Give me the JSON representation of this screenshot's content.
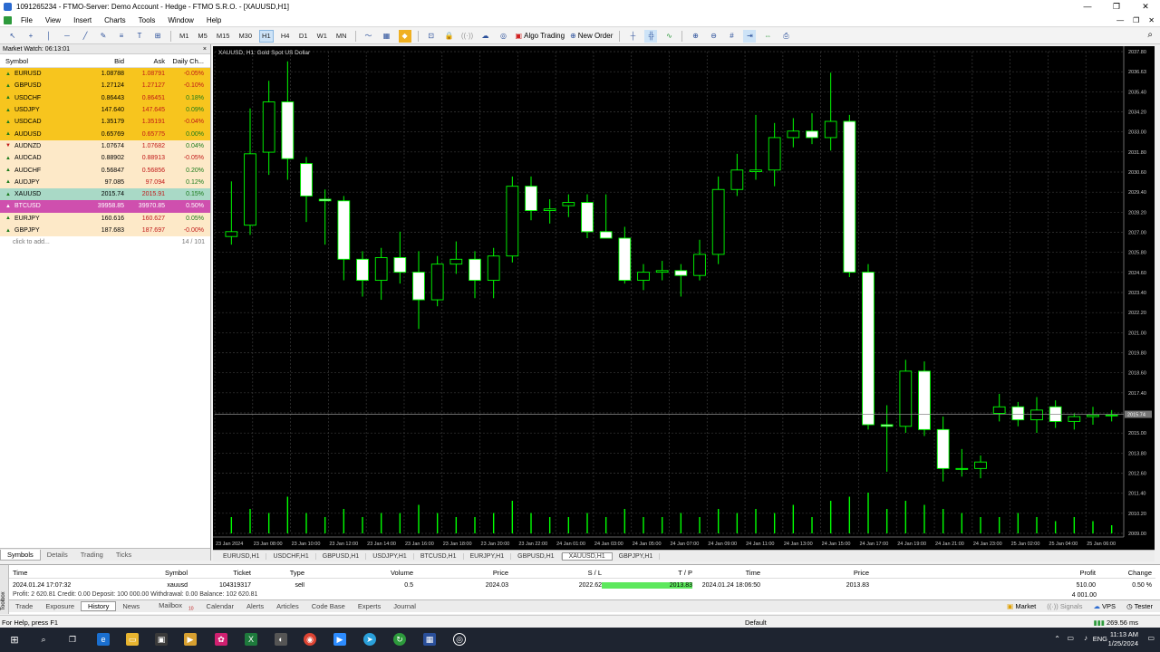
{
  "window": {
    "title": "1091265234 - FTMO-Server: Demo Account - Hedge - FTMO S.R.O. - [XAUUSD,H1]",
    "controls": [
      "—",
      "❐",
      "✕"
    ]
  },
  "menu": {
    "items": [
      "File",
      "View",
      "Insert",
      "Charts",
      "Tools",
      "Window",
      "Help"
    ],
    "mdi_controls": [
      "—",
      "❐",
      "✕"
    ]
  },
  "toolbar": {
    "timeframes": [
      "M1",
      "M5",
      "M15",
      "M30",
      "H1",
      "H4",
      "D1",
      "W1",
      "MN"
    ],
    "active_timeframe": "H1",
    "algo_trading_label": "Algo Trading",
    "new_order_label": "New Order"
  },
  "market_watch": {
    "title": "Market Watch: 06:13:01",
    "headers": {
      "symbol": "Symbol",
      "bid": "Bid",
      "ask": "Ask",
      "change": "Daily Ch..."
    },
    "rows": [
      {
        "symbol": "EURUSD",
        "bid": "1.08788",
        "ask": "1.08791",
        "change": "-0.05%",
        "bg": "#f7c51e",
        "dir": "up"
      },
      {
        "symbol": "GBPUSD",
        "bid": "1.27124",
        "ask": "1.27127",
        "change": "-0.10%",
        "bg": "#f7c51e",
        "dir": "up"
      },
      {
        "symbol": "USDCHF",
        "bid": "0.86443",
        "ask": "0.86451",
        "change": "0.18%",
        "bg": "#f7c51e",
        "dir": "up"
      },
      {
        "symbol": "USDJPY",
        "bid": "147.640",
        "ask": "147.645",
        "change": "0.09%",
        "bg": "#f7c51e",
        "dir": "up"
      },
      {
        "symbol": "USDCAD",
        "bid": "1.35179",
        "ask": "1.35191",
        "change": "-0.04%",
        "bg": "#f7c51e",
        "dir": "up"
      },
      {
        "symbol": "AUDUSD",
        "bid": "0.65769",
        "ask": "0.65775",
        "change": "0.00%",
        "bg": "#f7c51e",
        "dir": "up"
      },
      {
        "symbol": "AUDNZD",
        "bid": "1.07674",
        "ask": "1.07682",
        "change": "0.04%",
        "bg": "#fde9c8",
        "dir": "dn"
      },
      {
        "symbol": "AUDCAD",
        "bid": "0.88902",
        "ask": "0.88913",
        "change": "-0.05%",
        "bg": "#fde9c8",
        "dir": "up"
      },
      {
        "symbol": "AUDCHF",
        "bid": "0.56847",
        "ask": "0.56856",
        "change": "0.20%",
        "bg": "#fde9c8",
        "dir": "up"
      },
      {
        "symbol": "AUDJPY",
        "bid": "97.085",
        "ask": "97.094",
        "change": "0.12%",
        "bg": "#fde9c8",
        "dir": "up"
      },
      {
        "symbol": "XAUUSD",
        "bid": "2015.74",
        "ask": "2015.91",
        "change": "0.15%",
        "bg": "#a9d9c6",
        "dir": "up"
      },
      {
        "symbol": "BTCUSD",
        "bid": "39958.85",
        "ask": "39970.85",
        "change": "0.50%",
        "bg": "#cf4fae",
        "dir": "up"
      },
      {
        "symbol": "EURJPY",
        "bid": "160.616",
        "ask": "160.627",
        "change": "0.05%",
        "bg": "#fde9c8",
        "dir": "up"
      },
      {
        "symbol": "GBPJPY",
        "bid": "187.683",
        "ask": "187.697",
        "change": "-0.00%",
        "bg": "#fde9c8",
        "dir": "up"
      }
    ],
    "add_label": "click to add...",
    "count": "14 / 101",
    "tabs": [
      "Symbols",
      "Details",
      "Trading",
      "Ticks"
    ],
    "active_tab": "Symbols"
  },
  "chart": {
    "title": "XAUUSD, H1:  Gold Spot US Dollar",
    "current_price_label": "2015.74",
    "tabs": [
      "EURUSD,H1",
      "USDCHF,H1",
      "GBPUSD,H1",
      "USDJPY,H1",
      "BTCUSD,H1",
      "EURJPY,H1",
      "GBPUSD,H1",
      "XAUUSD,H1",
      "GBPJPY,H1"
    ],
    "active_tab": "XAUUSD,H1"
  },
  "chart_data": {
    "type": "candlestick",
    "symbol": "XAUUSD",
    "timeframe": "H1",
    "price_ticks": [
      "2037.80",
      "2036.63",
      "2035.40",
      "2034.20",
      "2033.00",
      "2031.80",
      "2030.60",
      "2029.40",
      "2028.20",
      "2027.00",
      "2025.80",
      "2024.60",
      "2023.40",
      "2022.20",
      "2021.00",
      "2019.80",
      "2018.60",
      "2017.40",
      "2016.20",
      "2015.00",
      "2013.80",
      "2012.60",
      "2011.40",
      "2010.20",
      "2009.00"
    ],
    "time_ticks": [
      "23 Jan 2024",
      "23 Jan 08:00",
      "23 Jan 10:00",
      "23 Jan 12:00",
      "23 Jan 14:00",
      "23 Jan 16:00",
      "23 Jan 18:00",
      "23 Jan 20:00",
      "23 Jan 22:00",
      "24 Jan 01:00",
      "24 Jan 03:00",
      "24 Jan 05:00",
      "24 Jan 07:00",
      "24 Jan 09:00",
      "24 Jan 11:00",
      "24 Jan 13:00",
      "24 Jan 15:00",
      "24 Jan 17:00",
      "24 Jan 19:00",
      "24 Jan 21:00",
      "24 Jan 23:00",
      "25 Jan 02:00",
      "25 Jan 04:00",
      "25 Jan 06:00"
    ],
    "ylim": [
      2008.4,
      2038.1
    ],
    "candles": [
      {
        "o": 2026.7,
        "h": 2030.1,
        "l": 2026.2,
        "c": 2027.0
      },
      {
        "o": 2027.4,
        "h": 2034.6,
        "l": 2026.8,
        "c": 2031.8
      },
      {
        "o": 2031.9,
        "h": 2036.3,
        "l": 2030.5,
        "c": 2035.0
      },
      {
        "o": 2035.0,
        "h": 2037.5,
        "l": 2030.2,
        "c": 2031.5
      },
      {
        "o": 2031.2,
        "h": 2031.6,
        "l": 2027.6,
        "c": 2029.2
      },
      {
        "o": 2029.0,
        "h": 2029.6,
        "l": 2026.2,
        "c": 2028.9
      },
      {
        "o": 2028.9,
        "h": 2029.2,
        "l": 2024.0,
        "c": 2025.3
      },
      {
        "o": 2025.3,
        "h": 2025.8,
        "l": 2023.0,
        "c": 2024.0
      },
      {
        "o": 2024.0,
        "h": 2026.0,
        "l": 2022.8,
        "c": 2025.4
      },
      {
        "o": 2025.4,
        "h": 2027.0,
        "l": 2023.8,
        "c": 2024.5
      },
      {
        "o": 2024.5,
        "h": 2025.8,
        "l": 2021.0,
        "c": 2022.8
      },
      {
        "o": 2022.8,
        "h": 2025.5,
        "l": 2022.4,
        "c": 2025.0
      },
      {
        "o": 2025.0,
        "h": 2026.4,
        "l": 2024.4,
        "c": 2025.3
      },
      {
        "o": 2025.3,
        "h": 2025.8,
        "l": 2022.9,
        "c": 2024.0
      },
      {
        "o": 2024.0,
        "h": 2026.0,
        "l": 2022.9,
        "c": 2025.5
      },
      {
        "o": 2025.5,
        "h": 2030.4,
        "l": 2025.1,
        "c": 2029.8
      },
      {
        "o": 2029.8,
        "h": 2030.4,
        "l": 2027.7,
        "c": 2028.3
      },
      {
        "o": 2028.3,
        "h": 2029.0,
        "l": 2027.5,
        "c": 2028.4
      },
      {
        "o": 2028.6,
        "h": 2029.3,
        "l": 2027.9,
        "c": 2028.8
      },
      {
        "o": 2028.8,
        "h": 2029.3,
        "l": 2026.6,
        "c": 2027.0
      },
      {
        "o": 2027.0,
        "h": 2029.3,
        "l": 2026.8,
        "c": 2026.6
      },
      {
        "o": 2026.6,
        "h": 2027.3,
        "l": 2023.8,
        "c": 2024.0
      },
      {
        "o": 2024.0,
        "h": 2025.0,
        "l": 2023.4,
        "c": 2024.5
      },
      {
        "o": 2024.5,
        "h": 2025.2,
        "l": 2024.0,
        "c": 2024.6
      },
      {
        "o": 2024.6,
        "h": 2025.0,
        "l": 2023.0,
        "c": 2024.3
      },
      {
        "o": 2024.3,
        "h": 2026.5,
        "l": 2024.0,
        "c": 2025.6
      },
      {
        "o": 2025.6,
        "h": 2030.4,
        "l": 2025.0,
        "c": 2029.6
      },
      {
        "o": 2029.6,
        "h": 2031.8,
        "l": 2029.2,
        "c": 2030.8
      },
      {
        "o": 2030.7,
        "h": 2034.2,
        "l": 2030.2,
        "c": 2030.8
      },
      {
        "o": 2030.8,
        "h": 2033.7,
        "l": 2029.8,
        "c": 2032.8
      },
      {
        "o": 2032.8,
        "h": 2034.0,
        "l": 2032.2,
        "c": 2033.2
      },
      {
        "o": 2033.2,
        "h": 2034.3,
        "l": 2032.4,
        "c": 2032.8
      },
      {
        "o": 2032.8,
        "h": 2036.8,
        "l": 2032.0,
        "c": 2033.8
      },
      {
        "o": 2033.8,
        "h": 2034.2,
        "l": 2024.2,
        "c": 2024.5
      },
      {
        "o": 2024.5,
        "h": 2025.0,
        "l": 2014.8,
        "c": 2015.1
      },
      {
        "o": 2015.1,
        "h": 2016.3,
        "l": 2012.2,
        "c": 2015.0
      },
      {
        "o": 2015.0,
        "h": 2019.1,
        "l": 2014.6,
        "c": 2018.4
      },
      {
        "o": 2018.4,
        "h": 2019.0,
        "l": 2014.4,
        "c": 2014.8
      },
      {
        "o": 2014.8,
        "h": 2015.6,
        "l": 2011.6,
        "c": 2012.4
      },
      {
        "o": 2012.4,
        "h": 2013.6,
        "l": 2011.9,
        "c": 2012.4
      },
      {
        "o": 2012.4,
        "h": 2013.2,
        "l": 2011.8,
        "c": 2012.8
      },
      {
        "o": 2015.8,
        "h": 2017.0,
        "l": 2015.3,
        "c": 2016.2
      },
      {
        "o": 2016.2,
        "h": 2016.5,
        "l": 2015.0,
        "c": 2015.4
      },
      {
        "o": 2015.4,
        "h": 2016.8,
        "l": 2014.6,
        "c": 2016.0
      },
      {
        "o": 2016.2,
        "h": 2016.6,
        "l": 2014.9,
        "c": 2015.3
      },
      {
        "o": 2015.3,
        "h": 2015.8,
        "l": 2014.8,
        "c": 2015.6
      },
      {
        "o": 2015.6,
        "h": 2016.2,
        "l": 2015.1,
        "c": 2015.7
      },
      {
        "o": 2015.7,
        "h": 2016.0,
        "l": 2015.3,
        "c": 2015.7
      }
    ],
    "volumes": [
      4,
      6,
      5,
      9,
      5,
      4,
      6,
      4,
      5,
      5,
      7,
      5,
      4,
      4,
      5,
      8,
      5,
      4,
      4,
      5,
      4,
      6,
      4,
      4,
      5,
      4,
      6,
      5,
      6,
      5,
      7,
      4,
      8,
      9,
      10,
      6,
      8,
      7,
      6,
      5,
      4,
      4,
      5,
      4,
      3,
      4,
      3,
      2
    ]
  },
  "history": {
    "headers": [
      "Time",
      "Symbol",
      "Ticket",
      "Type",
      "Volume",
      "Price",
      "S / L",
      "T / P",
      "Time",
      "Price",
      "Profit",
      "Change"
    ],
    "row": {
      "time": "2024.01.24 17:07:32",
      "symbol": "xauusd",
      "ticket": "104319317",
      "type": "sell",
      "volume": "0.5",
      "price": "2024.03",
      "sl": "2022.62",
      "tp": "2013.83",
      "close_time": "2024.01.24 18:06:50",
      "close_price": "2013.83",
      "profit": "510.00",
      "change": "0.50 %"
    },
    "summary": "Profit: 2 620.81  Credit: 0.00  Deposit: 100 000.00  Withdrawal: 0.00  Balance: 102 620.81",
    "right_value": "4 001.00"
  },
  "toolbox": {
    "vertical_label": "Toolbox",
    "tabs": [
      "Trade",
      "Exposure",
      "History",
      "News",
      "Mailbox",
      "Calendar",
      "Alerts",
      "Articles",
      "Code Base",
      "Experts",
      "Journal"
    ],
    "active_tab": "History",
    "mailbox_badge": "10",
    "right_items": [
      "Market",
      "Signals",
      "VPS",
      "Tester"
    ]
  },
  "statusbar": {
    "left": "For Help, press F1",
    "center": "Default",
    "right": "269.56 ms"
  },
  "taskbar": {
    "time": "11:13 AM",
    "date": "1/25/2024",
    "lang": "ENG"
  }
}
